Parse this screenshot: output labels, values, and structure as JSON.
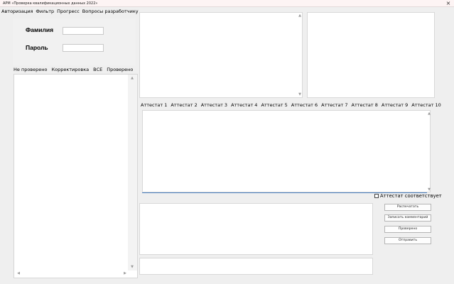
{
  "window": {
    "title": "АРМ «Проверка квалификационных данных 2022»",
    "close": "×"
  },
  "menu": {
    "items": [
      "Авторизация",
      "Фильтр",
      "Прогресс",
      "Вопросы разработчику"
    ]
  },
  "login": {
    "surname_label": "Фамилия",
    "surname_value": "",
    "password_label": "Пароль",
    "password_value": ""
  },
  "left_tabs": [
    "Не проверено",
    "Корректировка",
    "ВСЕ",
    "Проверено"
  ],
  "scroll_arrows": {
    "up": "▲",
    "down": "▼",
    "left": "◀",
    "right": "▶"
  },
  "attestat_tabs": [
    "Аттестат 1",
    "Аттестат 2",
    "Аттестат 3",
    "Аттестат 4",
    "Аттестат 5",
    "Аттестат 6",
    "Аттестат 7",
    "Аттестат 8",
    "Аттестат 9",
    "Аттестат 10"
  ],
  "checkbox": {
    "label": "Аттестат соответствует",
    "checked": false
  },
  "buttons": {
    "print": "Распечатать",
    "save_comment": "Записать комментарий",
    "checked": "Проверено",
    "send": "Отправить"
  }
}
